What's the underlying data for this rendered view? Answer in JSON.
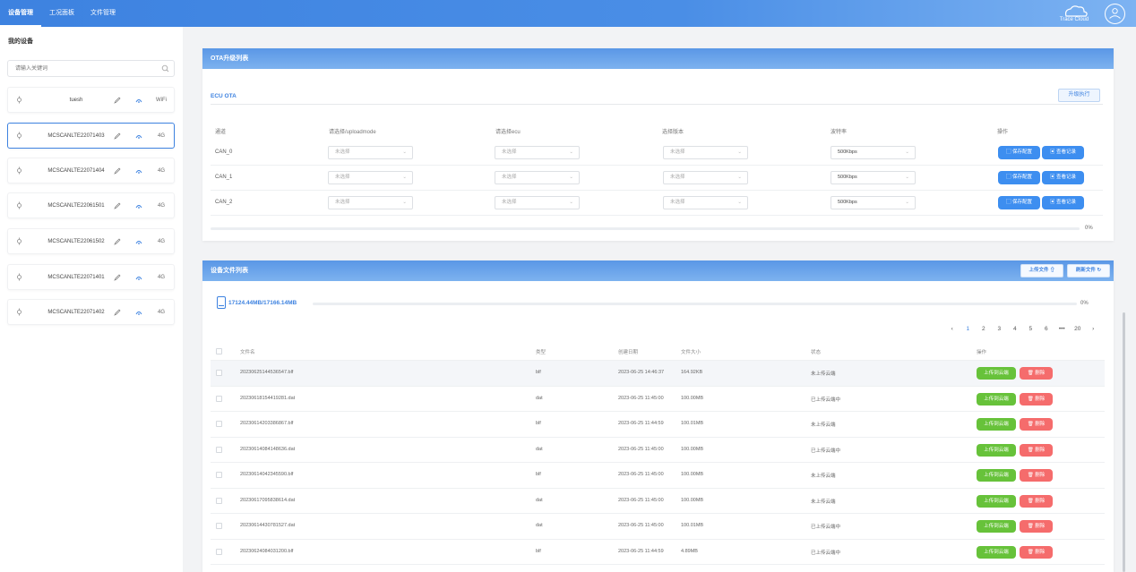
{
  "nav": {
    "tabs": [
      "设备管理",
      "工况面板",
      "文件管理"
    ],
    "brand": "Trace Cloud"
  },
  "sidebar": {
    "title": "我的设备",
    "search_placeholder": "请输入关键词",
    "devices": [
      {
        "name": "tuesh",
        "net": "WiFi"
      },
      {
        "name": "MCSCANLTE22071403",
        "net": "4G",
        "active": true
      },
      {
        "name": "MCSCANLTE22071404",
        "net": "4G"
      },
      {
        "name": "MCSCANLTE22061501",
        "net": "4G"
      },
      {
        "name": "MCSCANLTE22061502",
        "net": "4G"
      },
      {
        "name": "MCSCANLTE22071401",
        "net": "4G"
      },
      {
        "name": "MCSCANLTE22071402",
        "net": "4G"
      }
    ]
  },
  "ota": {
    "title": "OTA升级列表",
    "section": "ECU OTA",
    "top_button": "升级执行",
    "headers": [
      "通道",
      "请选择/uploadmode",
      "请选择ecu",
      "选择版本",
      "波特率",
      "操作"
    ],
    "rows": [
      {
        "channel": "CAN_0",
        "s1": "未选择",
        "s2": "未选择",
        "s3": "未选择",
        "baud": "500Kbps"
      },
      {
        "channel": "CAN_1",
        "s1": "未选择",
        "s2": "未选择",
        "s3": "未选择",
        "baud": "500Kbps"
      },
      {
        "channel": "CAN_2",
        "s1": "未选择",
        "s2": "未选择",
        "s3": "未选择",
        "baud": "500Kbps"
      }
    ],
    "btn_save": "保存配置",
    "btn_view": "查看记录",
    "progress": "0%"
  },
  "files": {
    "title": "设备文件列表",
    "btn_upload": "上传文件",
    "btn_refresh": "刷新文件",
    "storage": "17124.44MB/17166.14MB",
    "progress": "0%",
    "pages": [
      "1",
      "2",
      "3",
      "4",
      "5",
      "6",
      "•••",
      "20"
    ],
    "headers": [
      "文件名",
      "类型",
      "创建日期",
      "文件大小",
      "状态",
      "操作"
    ],
    "rows": [
      {
        "name": "20230625144536547.blf",
        "type": "blf",
        "date": "2023-06-25 14:46:37",
        "size": "164.92KB",
        "status": "未上传云端"
      },
      {
        "name": "20230618154419281.dat",
        "type": "dat",
        "date": "2023-06-25 11:45:00",
        "size": "100.00MB",
        "status": "已上传云端中"
      },
      {
        "name": "20230614203386867.blf",
        "type": "blf",
        "date": "2023-06-25 11:44:59",
        "size": "100.01MB",
        "status": "未上传云端"
      },
      {
        "name": "20230614084148636.dat",
        "type": "dat",
        "date": "2023-06-25 11:45:00",
        "size": "100.00MB",
        "status": "已上传云端中"
      },
      {
        "name": "20230614042345590.blf",
        "type": "blf",
        "date": "2023-06-25 11:45:00",
        "size": "100.00MB",
        "status": "未上传云端"
      },
      {
        "name": "20230617095838614.dat",
        "type": "dat",
        "date": "2023-06-25 11:45:00",
        "size": "100.00MB",
        "status": "未上传云端"
      },
      {
        "name": "20230614430781527.dat",
        "type": "dat",
        "date": "2023-06-25 11:45:00",
        "size": "100.01MB",
        "status": "已上传云端中"
      },
      {
        "name": "20230624084031200.blf",
        "type": "blf",
        "date": "2023-06-25 11:44:59",
        "size": "4.89MB",
        "status": "已上传云端中"
      }
    ],
    "btn_upload_cloud": "上传到云端",
    "btn_delete": "删除"
  },
  "colors": {
    "accent": "#3d82e0",
    "green": "#67c23a",
    "red": "#f56c6c"
  }
}
